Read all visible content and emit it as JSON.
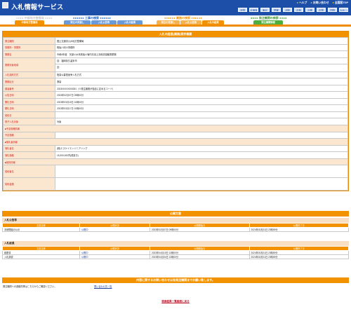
{
  "header": {
    "title": "入札情報サービス",
    "links": [
      "ヘルプ",
      "お問い合わせ",
      "全国版TOP"
    ],
    "regions": [
      "全国",
      "北海道",
      "東北",
      "関東",
      "北陸",
      "中部",
      "近畿",
      "中国",
      "四国",
      "九州・沖縄"
    ]
  },
  "nav": {
    "labels": [
      {
        "text": "中部地方整備局",
        "color": "#e0e0e0"
      },
      {
        "text": "工事の検索",
        "color": "#1e63c8"
      },
      {
        "text": "業務の検索",
        "color": "#f39200"
      },
      {
        "text": "発注機関の検索",
        "color": "#3a9a2a"
      }
    ],
    "tabs": [
      "中部地方整備局",
      "発注の見通し",
      "入札公告等",
      "入札の結果",
      "発注の見通し",
      "入札公告等",
      "入札の結果",
      "発注機関情報"
    ]
  },
  "detail": {
    "title": "入札の経過(業務)案件概要",
    "rows": [
      {
        "label": "発注機関",
        "value": "国土交通省九州地方整備局"
      },
      {
        "label": "事務所・事業所",
        "value": "筑後川河川事務所"
      },
      {
        "label": "業務名",
        "value": "令和6年度　矢部川水系筑後川管内鳥羽上流他流量観測業務"
      },
      {
        "label": "業務対象地域",
        "values": [
          "自：福岡県久留米市",
          "至："
        ]
      },
      {
        "label": "入札契約方式",
        "value": "簡易公募型競争入札方式"
      },
      {
        "label": "業務区分",
        "value": "測量"
      },
      {
        "label": "調達番号",
        "value": "20230XXXX000281（※発注機関が独自に定めるコード）"
      },
      {
        "label": "公告日時",
        "value": "2023年02月07日 09時00分"
      },
      {
        "label": "開札日時",
        "value": "2023年03月15日 10時00分"
      },
      {
        "label": "開札日時",
        "value": "2023年03月17日 10時00分"
      },
      {
        "label": "契約日",
        "value": ""
      },
      {
        "label": "電子入札対象",
        "value": "対象"
      }
    ],
    "sections": {
      "estimate": {
        "label": "■予定価格情報",
        "price_label": "予定価格",
        "price_value": ""
      },
      "winner": {
        "label": "■落札者情報",
        "name_label": "落札者名",
        "name_value": "(株)エスケイエンジニアリング",
        "amount_label": "落札価格",
        "amount_value": "15,300,000円(税抜き)"
      },
      "contract": {
        "label": "■契約情報",
        "name_label": "契約者名",
        "name_value": "",
        "amount_label": "契約金額",
        "amount_value": ""
      }
    }
  },
  "public_docs": {
    "title": "公開文書",
    "sections": [
      {
        "title": "入札公告等",
        "headers": [
          "文書名称",
          "公開状況",
          "公開開始日",
          "公開終了日"
        ],
        "rows": [
          {
            "name": "手続開始の公示",
            "status": "公開中",
            "start": "2023年02月07日 09時00分",
            "end": "2024年03月31日 23時59分"
          }
        ]
      },
      {
        "title": "入札経過",
        "headers": [
          "文書名称",
          "公開状況",
          "公開開始日",
          "公開終了日"
        ],
        "rows": [
          {
            "name": "経歴書",
            "status": "公開中",
            "start": "2023年04月15日 13時00分",
            "end": "2024年03月31日 23時59分"
          },
          {
            "name": "入札調書",
            "status": "公開中",
            "start": "2023年04月04日 13時00分",
            "end": "2024年03月31日 23時59分"
          }
        ]
      }
    ]
  },
  "contact": {
    "title": "内容に関するお問い合わせは各発注機関までお願い致します。",
    "text": "発注機関への連絡先等はこちらからご確認ください。",
    "link": "問い合わせ先一覧"
  },
  "footer": {
    "back_link": "検索結果一覧画面に戻る"
  }
}
